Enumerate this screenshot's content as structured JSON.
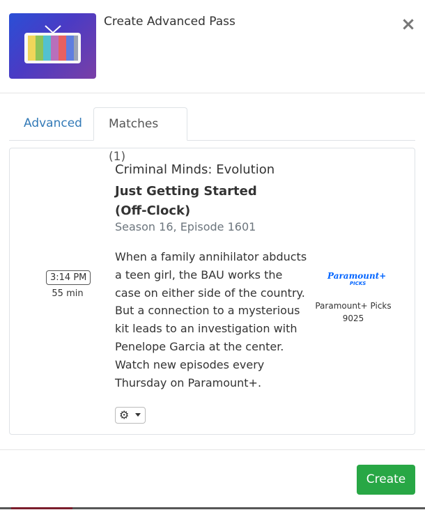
{
  "modal": {
    "title": "Create Advanced Pass",
    "thumbnail_icon": "tv-icon"
  },
  "tabs": [
    {
      "label": "Advanced",
      "active": false
    },
    {
      "label": "Matches (1)",
      "active": true
    }
  ],
  "match": {
    "time": "3:14 PM",
    "duration": "55 min",
    "series": "Criminal Minds: Evolution",
    "episode_title": "Just Getting Started (Off-Clock)",
    "episode_number": "Season 16, Episode 1601",
    "description": "When a family annihilator abducts a teen girl, the BAU works the case on either side of the country. But a connection to a mysterious kit leads to an investigation with Penelope Garcia at the center. Watch new episodes every Thursday on Paramount+.",
    "actions_icon": "gear-icon",
    "channel": {
      "logo_text": "Paramount+",
      "logo_subtext": "PICKS",
      "name": "Paramount+ Picks",
      "number": "9025"
    }
  },
  "footer": {
    "create_label": "Create"
  },
  "colors": {
    "link": "#337ab7",
    "primary_action": "#28a745",
    "paramount_blue": "#0064ff"
  }
}
